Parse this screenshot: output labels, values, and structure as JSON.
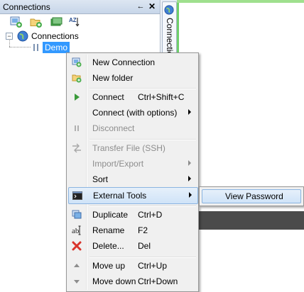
{
  "panel": {
    "title": "Connections",
    "pin_glyph": "←",
    "close_glyph": "✕",
    "toolbar": [
      {
        "icon": "new-connection-icon"
      },
      {
        "icon": "new-folder-icon"
      },
      {
        "icon": "view-icon"
      },
      {
        "icon": "sort-az-icon",
        "text": "AZ"
      }
    ]
  },
  "tree": {
    "root": {
      "expander": "−",
      "label": "Connections"
    },
    "child": {
      "label": "Demo"
    }
  },
  "side_tab": {
    "label": "Connections"
  },
  "menu": {
    "items": [
      {
        "label": "New Connection",
        "shortcut": ""
      },
      {
        "label": "New folder",
        "shortcut": ""
      },
      {
        "label": "Connect",
        "shortcut": "Ctrl+Shift+C"
      },
      {
        "label": "Connect (with options)",
        "shortcut": ""
      },
      {
        "label": "Disconnect",
        "shortcut": ""
      },
      {
        "label": "Transfer File (SSH)",
        "shortcut": ""
      },
      {
        "label": "Import/Export",
        "shortcut": ""
      },
      {
        "label": "Sort",
        "shortcut": ""
      },
      {
        "label": "External Tools",
        "shortcut": ""
      },
      {
        "label": "Duplicate",
        "shortcut": "Ctrl+D"
      },
      {
        "label": "Rename",
        "shortcut": "F2"
      },
      {
        "label": "Delete...",
        "shortcut": "Del"
      },
      {
        "label": "Move up",
        "shortcut": "Ctrl+Up"
      },
      {
        "label": "Move down",
        "shortcut": "Ctrl+Down"
      }
    ]
  },
  "submenu": {
    "items": [
      {
        "label": "View Password"
      }
    ]
  },
  "colors": {
    "selection": "#3399ff",
    "highlight_border": "#8bb4e0",
    "accent_green": "#6fcf6a"
  }
}
